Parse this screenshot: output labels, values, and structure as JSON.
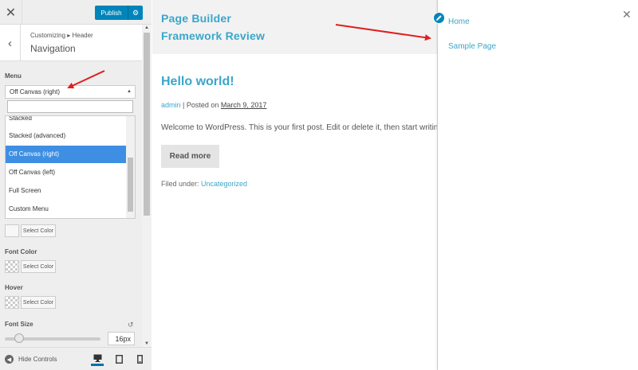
{
  "toolbar": {
    "close_icon": "close-icon",
    "publish_label": "Publish",
    "gear_icon": "gear-icon"
  },
  "section": {
    "breadcrumb": "Customizing ▸ Header",
    "title": "Navigation"
  },
  "controls": {
    "menu_label": "Menu",
    "menu_value": "Off Canvas (right)",
    "menu_options": [
      {
        "label": "Stacked",
        "selected": false
      },
      {
        "label": "Stacked (advanced)",
        "selected": false
      },
      {
        "label": "Off Canvas (right)",
        "selected": true
      },
      {
        "label": "Off Canvas (left)",
        "selected": false
      },
      {
        "label": "Full Screen",
        "selected": false
      },
      {
        "label": "Custom Menu",
        "selected": false
      }
    ],
    "select_color_label": "Select Color",
    "font_color_label": "Font Color",
    "hover_label": "Hover",
    "font_size_label": "Font Size",
    "font_size_value": "16px",
    "font_size_slider_fraction": 0.15
  },
  "footer": {
    "hide_controls_label": "Hide Controls"
  },
  "preview": {
    "site_title_line1": "Page Builder",
    "site_title_line2": "Framework Review",
    "post_title": "Hello world!",
    "post_author": "admin",
    "post_meta_sep": " | Posted on ",
    "post_date": "March 9, 2017",
    "post_excerpt": "Welcome to WordPress. This is your first post. Edit or delete it, then start writing!",
    "read_more_label": "Read more",
    "filed_under_prefix": "Filed under: ",
    "category": "Uncategorized"
  },
  "offcanvas": {
    "items": [
      "Home",
      "Sample Page"
    ]
  },
  "colors": {
    "accent": "#3aa6c9",
    "publish": "#0085ba",
    "selected_option": "#3e8fe3",
    "arrow": "#e02020"
  }
}
